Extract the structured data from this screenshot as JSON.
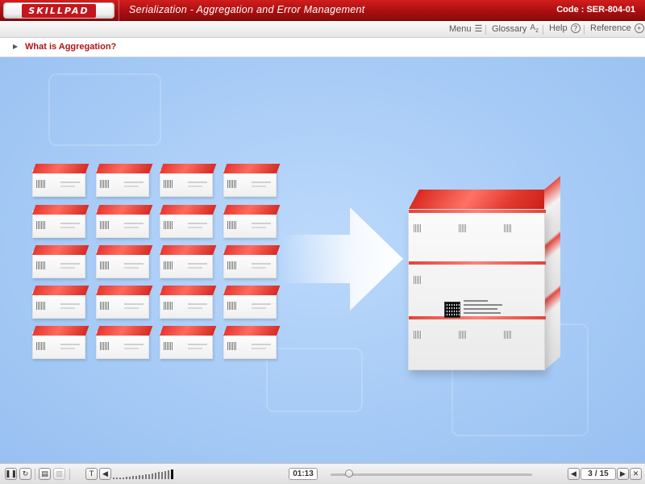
{
  "header": {
    "logo_text": "SKILLPAD",
    "course_title": "Serialization - Aggregation and Error Management",
    "code_label": "Code : SER-804-01"
  },
  "toolbar": {
    "items": [
      {
        "label": "Menu",
        "icon": "menu-icon"
      },
      {
        "label": "Glossary",
        "icon": "glossary-az-icon"
      },
      {
        "label": "Help",
        "icon": "help-icon"
      },
      {
        "label": "Reference",
        "icon": "plus-circle-icon"
      }
    ]
  },
  "topic": {
    "title": "What is Aggregation?"
  },
  "stage": {
    "description_icon_left": "grid-of-product-cartons",
    "description_icon_center": "right-arrow-icon",
    "description_icon_right": "aggregated-shipping-bundle"
  },
  "player": {
    "time": "01:13",
    "progress_fraction": 0.07,
    "page_current": "3",
    "page_separator": "/",
    "page_total": "15",
    "buttons": [
      {
        "name": "pause-button",
        "glyph": "❚❚"
      },
      {
        "name": "replay-button",
        "glyph": "↻"
      },
      {
        "name": "transcript-button",
        "glyph": "▤"
      },
      {
        "name": "notes-button",
        "glyph": "▥"
      },
      {
        "name": "text-button",
        "glyph": "T"
      },
      {
        "name": "volume-button",
        "glyph": "◀"
      },
      {
        "name": "prev-page-button",
        "glyph": "◀"
      },
      {
        "name": "next-page-button",
        "glyph": "▶"
      },
      {
        "name": "close-button",
        "glyph": "✕"
      }
    ]
  },
  "colors": {
    "brand_red": "#c4161c",
    "stage_blue": "#a7cbf6",
    "topic_red": "#b01313"
  }
}
